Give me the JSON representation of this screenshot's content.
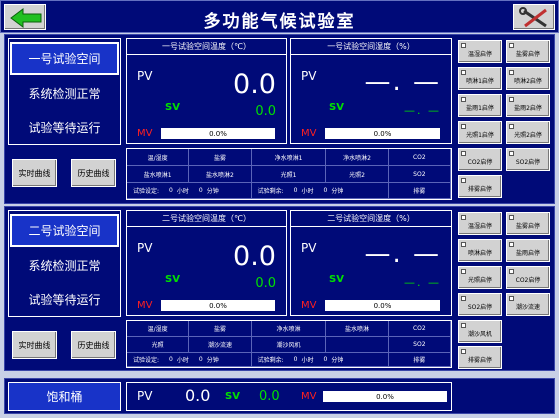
{
  "app": {
    "title": "多功能气候试验室",
    "accent": "#000a78",
    "green": "#00e000",
    "red": "#ff2020"
  },
  "header": {
    "back_icon": "green-back-arrow-icon",
    "tools_icon": "wrench-screwdriver-icon"
  },
  "lab1": {
    "nav": [
      "一号试验空间",
      "系统检测正常",
      "试验等待运行"
    ],
    "buttons": {
      "realtime": "实时曲线",
      "history": "历史曲线"
    },
    "temp": {
      "head": "一号试验空间温度（℃）",
      "pv_label": "PV",
      "sv_label": "SV",
      "mv_label": "MV",
      "pv": "0.0",
      "sv": "0.0",
      "mv": "0.0%"
    },
    "hum": {
      "head": "一号试验空间湿度（%）",
      "pv_label": "PV",
      "sv_label": "SV",
      "mv_label": "MV",
      "pv": "—. —",
      "sv": "—. —",
      "mv": "0.0%"
    },
    "grid": [
      [
        "温/湿度",
        "盐雾",
        "净水喷淋1",
        "净水喷淋2",
        "CO2"
      ],
      [
        "盐水喷淋1",
        "盐水喷淋2",
        "光照1",
        "光照2",
        "SO2"
      ]
    ],
    "timer": {
      "set_label": "试验设定:",
      "set_h": "0",
      "h_unit": "小时",
      "set_m": "0",
      "m_unit": "分钟",
      "remain_label": "试验剩余:",
      "rem_h": "0",
      "rem_m": "0",
      "last": "排雾"
    },
    "switches": [
      "温湿启停",
      "盐雾启停",
      "喷淋1启停",
      "喷淋2启停",
      "盐雨1启停",
      "盐雨2启停",
      "光照1启停",
      "光照2启停",
      "CO2启停",
      "SO2启停",
      "排雾启停"
    ]
  },
  "lab2": {
    "nav": [
      "二号试验空间",
      "系统检测正常",
      "试验等待运行"
    ],
    "buttons": {
      "realtime": "实时曲线",
      "history": "历史曲线"
    },
    "temp": {
      "head": "二号试验空间温度（℃）",
      "pv_label": "PV",
      "sv_label": "SV",
      "mv_label": "MV",
      "pv": "0.0",
      "sv": "0.0",
      "mv": "0.0%"
    },
    "hum": {
      "head": "二号试验空间湿度（%）",
      "pv_label": "PV",
      "sv_label": "SV",
      "mv_label": "MV",
      "pv": "—. —",
      "sv": "—. —",
      "mv": "0.0%"
    },
    "grid": [
      [
        "温/湿度",
        "盐雾",
        "净水喷淋",
        "盐水喷淋",
        "CO2"
      ],
      [
        "光照",
        "潮沙流速",
        "潮沙风机",
        "",
        "SO2"
      ]
    ],
    "timer": {
      "set_label": "试验设定:",
      "set_h": "0",
      "h_unit": "小时",
      "set_m": "0",
      "m_unit": "分钟",
      "remain_label": "试验剩余:",
      "rem_h": "0",
      "rem_m": "0",
      "last": "排雾"
    },
    "switches": [
      "温湿启停",
      "盐雾启停",
      "喷淋启停",
      "盐雨启停",
      "光照启停",
      "CO2启停",
      "SO2启停",
      "潮沙流速",
      "潮沙风机",
      "排雾启停"
    ]
  },
  "bottom": {
    "label": "饱和桶",
    "pv_label": "PV",
    "pv": "0.0",
    "sv_label": "SV",
    "sv": "0.0",
    "mv_label": "MV",
    "mv": "0.0%"
  }
}
